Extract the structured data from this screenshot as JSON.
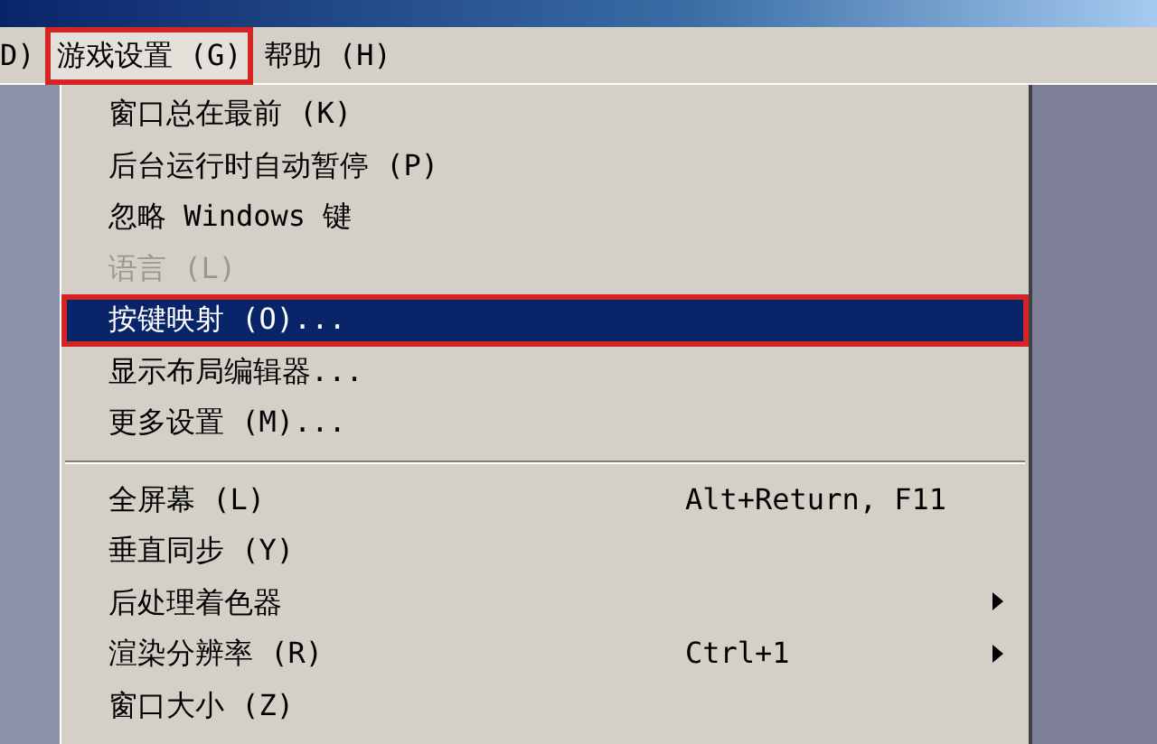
{
  "menu_bar": [
    {
      "label": "D)",
      "selected": false,
      "annotated": false
    },
    {
      "label": "游戏设置 (G)",
      "selected": true,
      "annotated": true
    },
    {
      "label": "帮助 (H)",
      "selected": false,
      "annotated": false
    }
  ],
  "menu": {
    "items": [
      {
        "kind": "item",
        "label": "窗口总在最前 (K)",
        "selected": false,
        "disabled": false,
        "annotated": false
      },
      {
        "kind": "item",
        "label": "后台运行时自动暂停 (P)",
        "selected": false,
        "disabled": false,
        "annotated": false
      },
      {
        "kind": "item",
        "label": "忽略 Windows 键",
        "selected": false,
        "disabled": false,
        "annotated": false
      },
      {
        "kind": "item",
        "label": "语言 (L)",
        "selected": false,
        "disabled": true,
        "annotated": false
      },
      {
        "kind": "item",
        "label": "按键映射 (O)...",
        "selected": true,
        "disabled": false,
        "annotated": true
      },
      {
        "kind": "item",
        "label": "显示布局编辑器...",
        "selected": false,
        "disabled": false,
        "annotated": false
      },
      {
        "kind": "item",
        "label": "更多设置 (M)...",
        "selected": false,
        "disabled": false,
        "annotated": false
      },
      {
        "kind": "separator"
      },
      {
        "kind": "item",
        "label": "全屏幕 (L)",
        "shortcut": "Alt+Return, F11",
        "selected": false,
        "disabled": false,
        "annotated": false
      },
      {
        "kind": "item",
        "label": "垂直同步 (Y)",
        "selected": false,
        "disabled": false,
        "annotated": false
      },
      {
        "kind": "submenu",
        "label": "后处理着色器",
        "selected": false,
        "disabled": false,
        "annotated": false
      },
      {
        "kind": "submenu",
        "label": "渲染分辨率 (R)",
        "shortcut": "Ctrl+1",
        "selected": false,
        "disabled": false,
        "annotated": false
      },
      {
        "kind": "item",
        "label": "窗口大小 (Z)",
        "selected": false,
        "disabled": false,
        "annotated": false
      }
    ]
  }
}
